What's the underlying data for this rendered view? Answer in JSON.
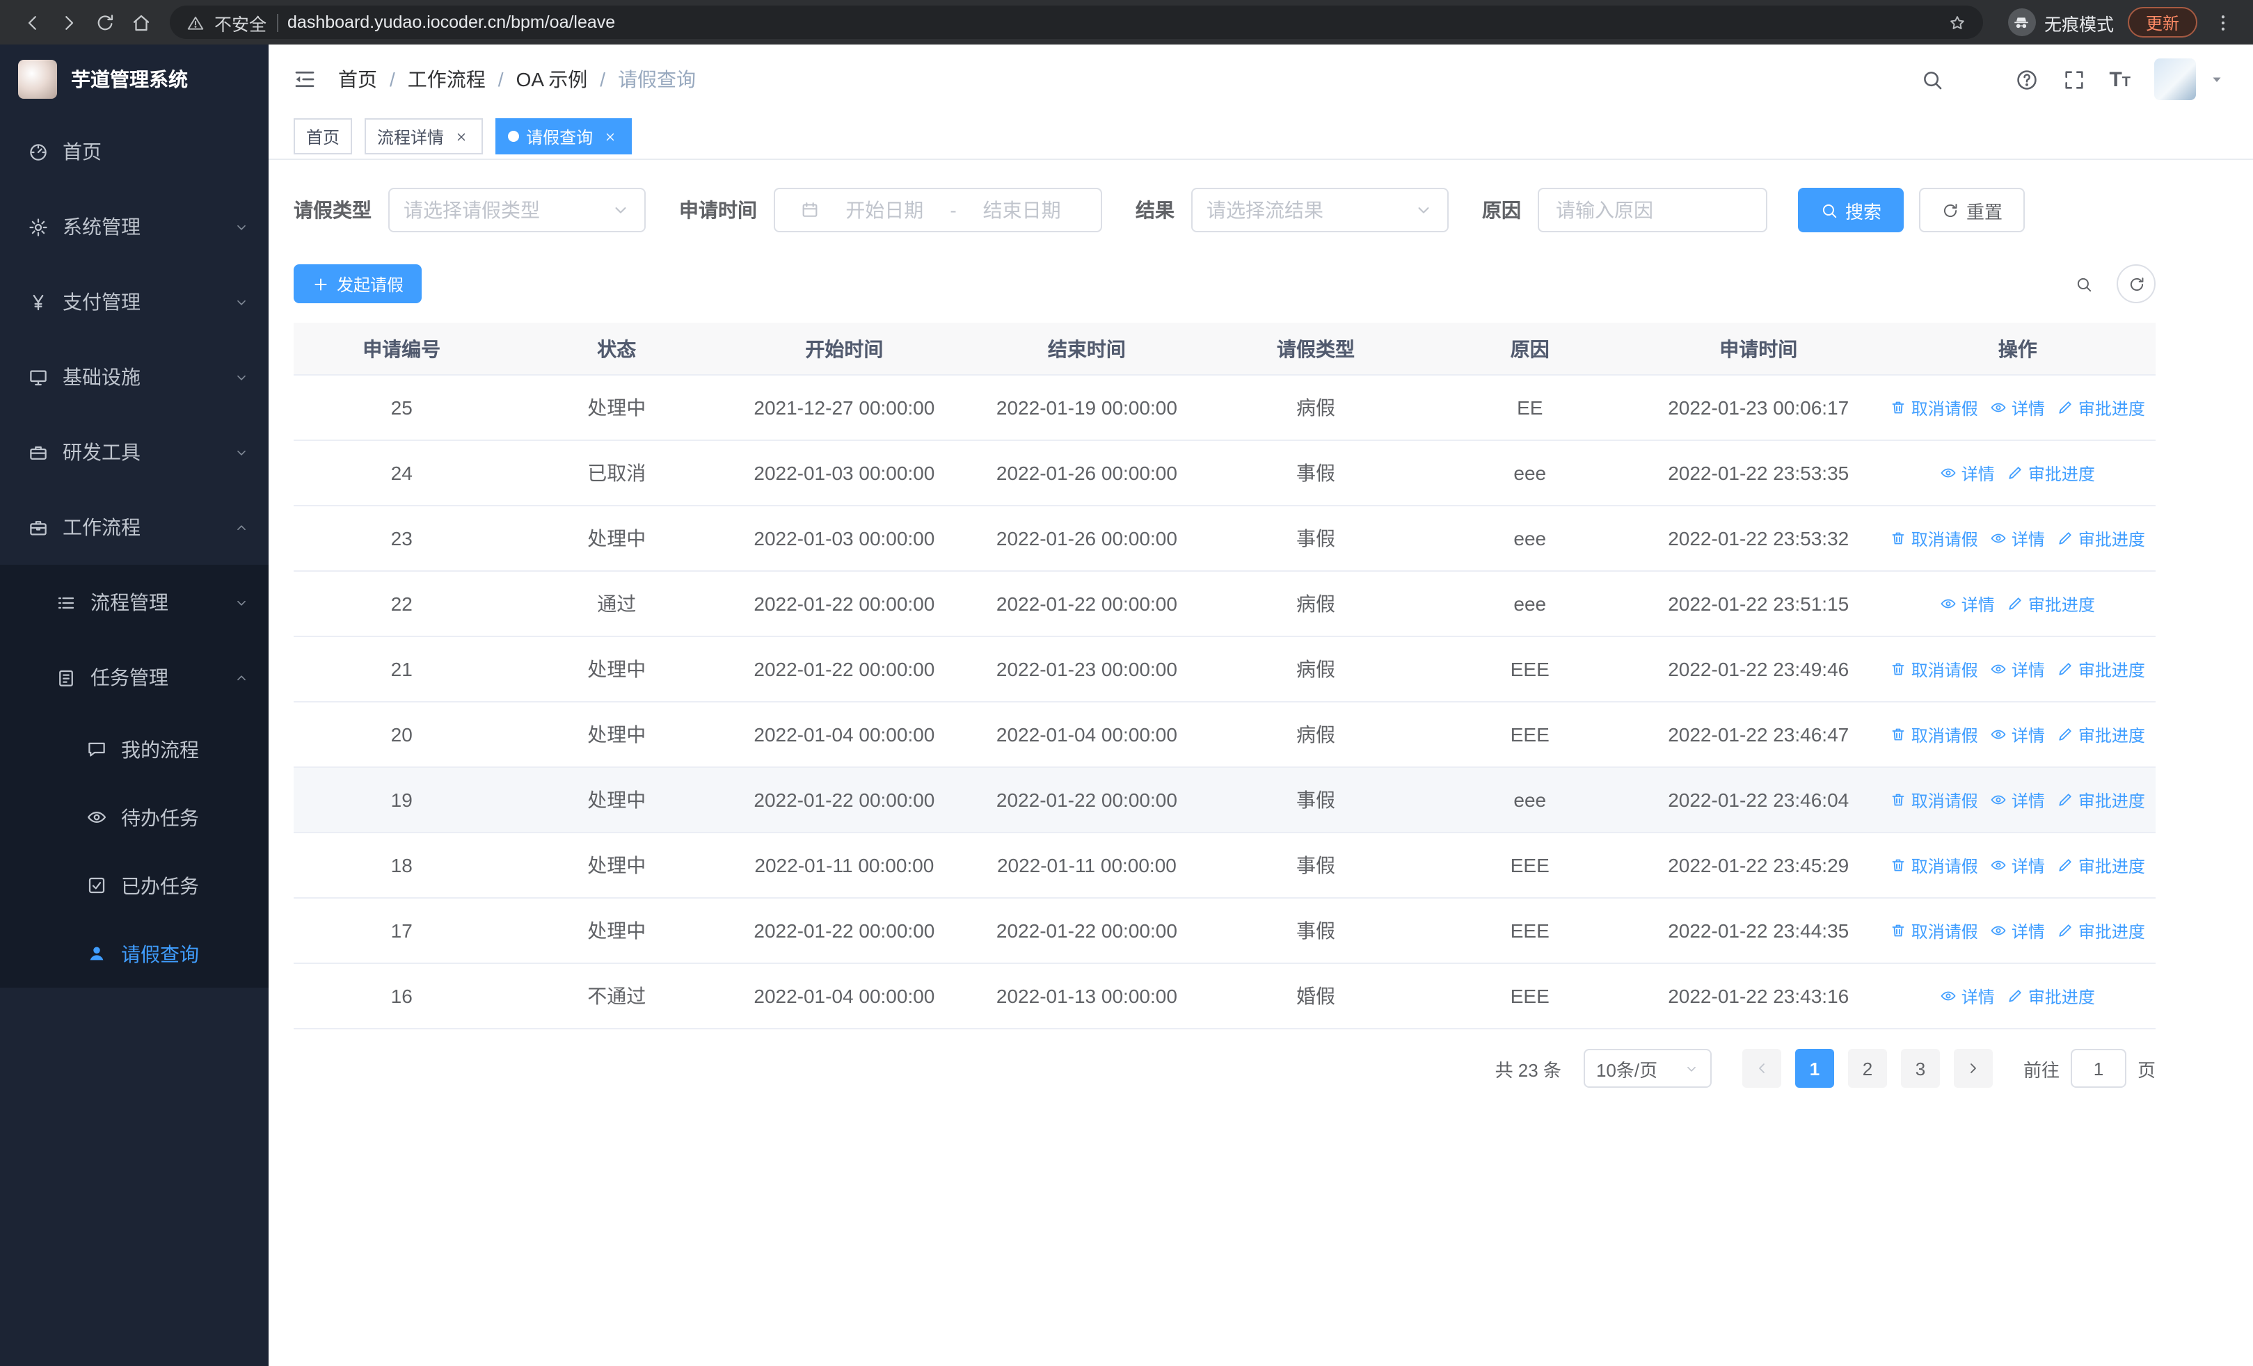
{
  "colors": {
    "primary": "#409eff"
  },
  "browser": {
    "security_warning": "不安全",
    "url": "dashboard.yudao.iocoder.cn/bpm/oa/leave",
    "incognito_label": "无痕模式",
    "update_button": "更新"
  },
  "sidebar": {
    "logo_title": "芋道管理系统",
    "menu": [
      {
        "key": "home",
        "icon": "dashboard",
        "label": "首页",
        "level": 1
      },
      {
        "key": "system",
        "icon": "gear",
        "label": "系统管理",
        "level": 1,
        "chevron": "down"
      },
      {
        "key": "payment",
        "icon": "yen",
        "label": "支付管理",
        "level": 1,
        "chevron": "down"
      },
      {
        "key": "infra",
        "icon": "monitor",
        "label": "基础设施",
        "level": 1,
        "chevron": "down"
      },
      {
        "key": "devtools",
        "icon": "toolbox",
        "label": "研发工具",
        "level": 1,
        "chevron": "down"
      },
      {
        "key": "workflow",
        "icon": "briefcase",
        "label": "工作流程",
        "level": 1,
        "chevron": "up"
      },
      {
        "key": "process-mgmt",
        "icon": "list",
        "label": "流程管理",
        "level": 2,
        "chevron": "down",
        "group": true
      },
      {
        "key": "task-mgmt",
        "icon": "task",
        "label": "任务管理",
        "level": 2,
        "chevron": "up",
        "group": true
      },
      {
        "key": "my-process",
        "icon": "chat",
        "label": "我的流程",
        "level": 3,
        "group": true
      },
      {
        "key": "todo-task",
        "icon": "eye",
        "label": "待办任务",
        "level": 3,
        "group": true
      },
      {
        "key": "done-task",
        "icon": "done",
        "label": "已办任务",
        "level": 3,
        "group": true
      },
      {
        "key": "leave-query",
        "icon": "user",
        "label": "请假查询",
        "level": 3,
        "group": true,
        "active": true
      }
    ]
  },
  "header": {
    "breadcrumb": [
      "首页",
      "工作流程",
      "OA 示例",
      "请假查询"
    ]
  },
  "tabs": [
    {
      "key": "home",
      "label": "首页",
      "active": false,
      "closable": false
    },
    {
      "key": "process-detail",
      "label": "流程详情",
      "active": false,
      "closable": true
    },
    {
      "key": "leave-query",
      "label": "请假查询",
      "active": true,
      "closable": true
    }
  ],
  "filters": {
    "leave_type_label": "请假类型",
    "leave_type_placeholder": "请选择请假类型",
    "apply_time_label": "申请时间",
    "start_date_placeholder": "开始日期",
    "range_separator": "-",
    "end_date_placeholder": "结束日期",
    "result_label": "结果",
    "result_placeholder": "请选择流结果",
    "reason_label": "原因",
    "reason_placeholder": "请输入原因",
    "search_button": "搜索",
    "reset_button": "重置"
  },
  "toolbar": {
    "create_button": "发起请假"
  },
  "table": {
    "columns": [
      "申请编号",
      "状态",
      "开始时间",
      "结束时间",
      "请假类型",
      "原因",
      "申请时间",
      "操作"
    ],
    "action_defs": {
      "cancel": {
        "label": "取消请假",
        "icon": "trash"
      },
      "detail": {
        "label": "详情",
        "icon": "eye"
      },
      "progress": {
        "label": "审批进度",
        "icon": "edit"
      }
    },
    "rows": [
      {
        "id": "25",
        "status": "处理中",
        "start": "2021-12-27 00:00:00",
        "end": "2022-01-19 00:00:00",
        "type": "病假",
        "reason": "EE",
        "apply_time": "2022-01-23 00:06:17",
        "actions": [
          "cancel",
          "detail",
          "progress"
        ]
      },
      {
        "id": "24",
        "status": "已取消",
        "start": "2022-01-03 00:00:00",
        "end": "2022-01-26 00:00:00",
        "type": "事假",
        "reason": "eee",
        "apply_time": "2022-01-22 23:53:35",
        "actions": [
          "detail",
          "progress"
        ]
      },
      {
        "id": "23",
        "status": "处理中",
        "start": "2022-01-03 00:00:00",
        "end": "2022-01-26 00:00:00",
        "type": "事假",
        "reason": "eee",
        "apply_time": "2022-01-22 23:53:32",
        "actions": [
          "cancel",
          "detail",
          "progress"
        ]
      },
      {
        "id": "22",
        "status": "通过",
        "start": "2022-01-22 00:00:00",
        "end": "2022-01-22 00:00:00",
        "type": "病假",
        "reason": "eee",
        "apply_time": "2022-01-22 23:51:15",
        "actions": [
          "detail",
          "progress"
        ]
      },
      {
        "id": "21",
        "status": "处理中",
        "start": "2022-01-22 00:00:00",
        "end": "2022-01-23 00:00:00",
        "type": "病假",
        "reason": "EEE",
        "apply_time": "2022-01-22 23:49:46",
        "actions": [
          "cancel",
          "detail",
          "progress"
        ]
      },
      {
        "id": "20",
        "status": "处理中",
        "start": "2022-01-04 00:00:00",
        "end": "2022-01-04 00:00:00",
        "type": "病假",
        "reason": "EEE",
        "apply_time": "2022-01-22 23:46:47",
        "actions": [
          "cancel",
          "detail",
          "progress"
        ]
      },
      {
        "id": "19",
        "status": "处理中",
        "start": "2022-01-22 00:00:00",
        "end": "2022-01-22 00:00:00",
        "type": "事假",
        "reason": "eee",
        "apply_time": "2022-01-22 23:46:04",
        "actions": [
          "cancel",
          "detail",
          "progress"
        ],
        "highlighted": true
      },
      {
        "id": "18",
        "status": "处理中",
        "start": "2022-01-11 00:00:00",
        "end": "2022-01-11 00:00:00",
        "type": "事假",
        "reason": "EEE",
        "apply_time": "2022-01-22 23:45:29",
        "actions": [
          "cancel",
          "detail",
          "progress"
        ]
      },
      {
        "id": "17",
        "status": "处理中",
        "start": "2022-01-22 00:00:00",
        "end": "2022-01-22 00:00:00",
        "type": "事假",
        "reason": "EEE",
        "apply_time": "2022-01-22 23:44:35",
        "actions": [
          "cancel",
          "detail",
          "progress"
        ]
      },
      {
        "id": "16",
        "status": "不通过",
        "start": "2022-01-04 00:00:00",
        "end": "2022-01-13 00:00:00",
        "type": "婚假",
        "reason": "EEE",
        "apply_time": "2022-01-22 23:43:16",
        "actions": [
          "detail",
          "progress"
        ]
      }
    ]
  },
  "pagination": {
    "total_text": "共 23 条",
    "page_size": "10条/页",
    "pages": [
      "1",
      "2",
      "3"
    ],
    "active_page": "1",
    "goto_label": "前往",
    "goto_value": "1",
    "page_label": "页"
  }
}
